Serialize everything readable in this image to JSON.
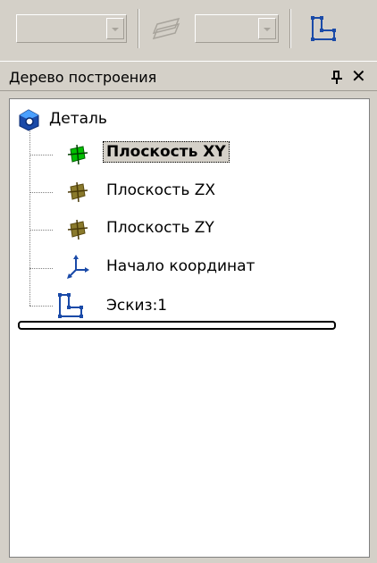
{
  "toolbar": {
    "combo1_value": "",
    "combo2_value": "",
    "layers_icon": "layers-icon",
    "sketch_icon": "sketch-icon"
  },
  "panel": {
    "title": "Дерево построения",
    "pin_icon": "pin-icon",
    "close_label": "✕"
  },
  "tree": {
    "root": {
      "label": "Деталь",
      "icon": "part-icon"
    },
    "items": [
      {
        "label": "Плоскость XY",
        "icon": "plane-icon",
        "selected": true,
        "color": "#00c000"
      },
      {
        "label": "Плоскость ZX",
        "icon": "plane-icon",
        "selected": false,
        "color": "#8a7a2c"
      },
      {
        "label": "Плоскость ZY",
        "icon": "plane-icon",
        "selected": false,
        "color": "#8a7a2c"
      },
      {
        "label": "Начало координат",
        "icon": "origin-icon",
        "selected": false
      },
      {
        "label": "Эскиз:1",
        "icon": "sketch-icon",
        "selected": false
      }
    ]
  },
  "colors": {
    "face": "#d4d0c8",
    "tree_bg": "#ffffff",
    "accent": "#1a4aa8"
  }
}
